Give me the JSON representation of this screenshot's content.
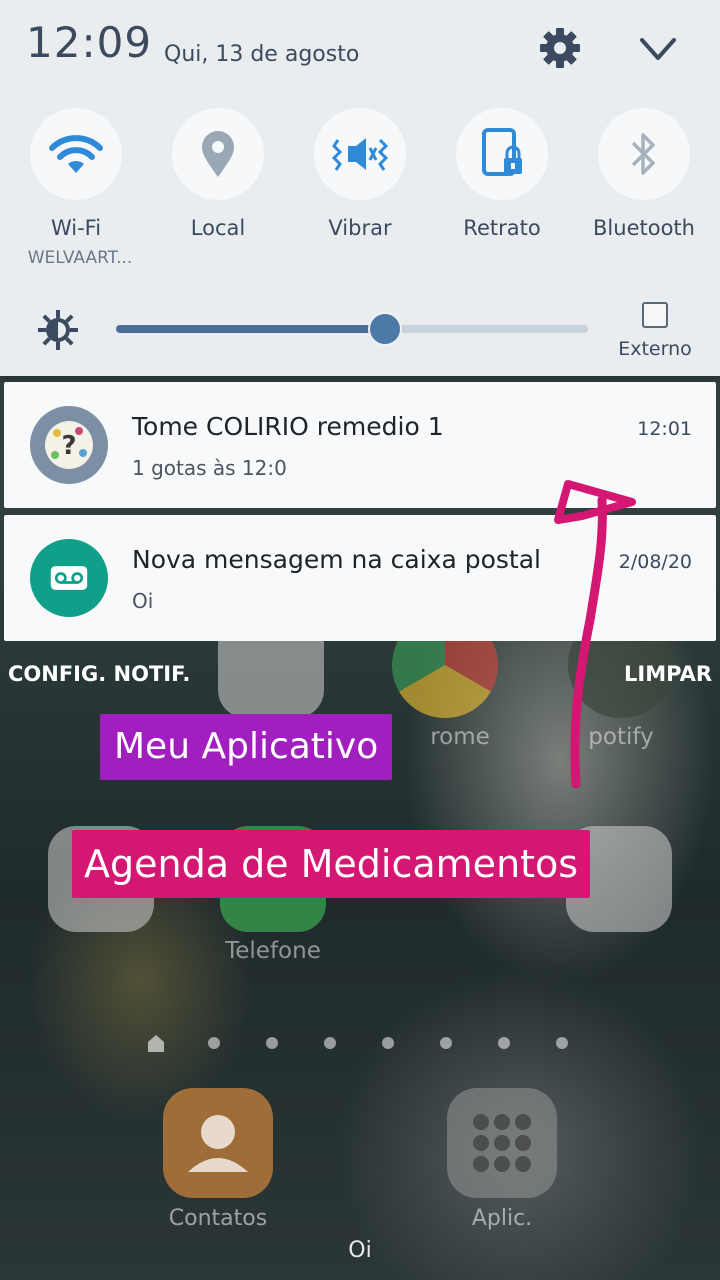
{
  "status": {
    "time": "12:09",
    "date": "Qui, 13 de agosto"
  },
  "quick_settings": [
    {
      "label": "Wi-Fi",
      "sublabel": "WELVAART...",
      "icon": "wifi-icon"
    },
    {
      "label": "Local",
      "icon": "location-pin-icon"
    },
    {
      "label": "Vibrar",
      "icon": "vibrate-icon"
    },
    {
      "label": "Retrato",
      "icon": "portrait-lock-icon"
    },
    {
      "label": "Bluetooth",
      "icon": "bluetooth-icon"
    }
  ],
  "brightness": {
    "level_percent": 57,
    "external_label": "Externo",
    "external_checked": false
  },
  "notifications": [
    {
      "title": "Tome COLIRIO remedio 1",
      "text": "1 gotas às 12:0",
      "time": "12:01",
      "icon": "medication-app-icon"
    },
    {
      "title": "Nova mensagem na caixa postal",
      "text": "Oi",
      "time": "2/08/20",
      "icon": "voicemail-icon"
    }
  ],
  "shade_actions": {
    "settings": "CONFIG. NOTIF.",
    "clear": "LIMPAR"
  },
  "home": {
    "apps": [
      "rome",
      "potify",
      "Telefone"
    ],
    "dock": [
      "Contatos",
      "Aplic."
    ],
    "bottom_text": "Oi"
  },
  "annotations": {
    "my_app": "Meu Aplicativo",
    "app_name": "Agenda de Medicamentos"
  },
  "colors": {
    "shade_bg": "#e9edef",
    "accent": "#4a6f96",
    "wifi_active": "#2f8bd8",
    "label_purple": "#a11fbf",
    "label_pink": "#d41772",
    "voicemail": "#10a08a"
  }
}
